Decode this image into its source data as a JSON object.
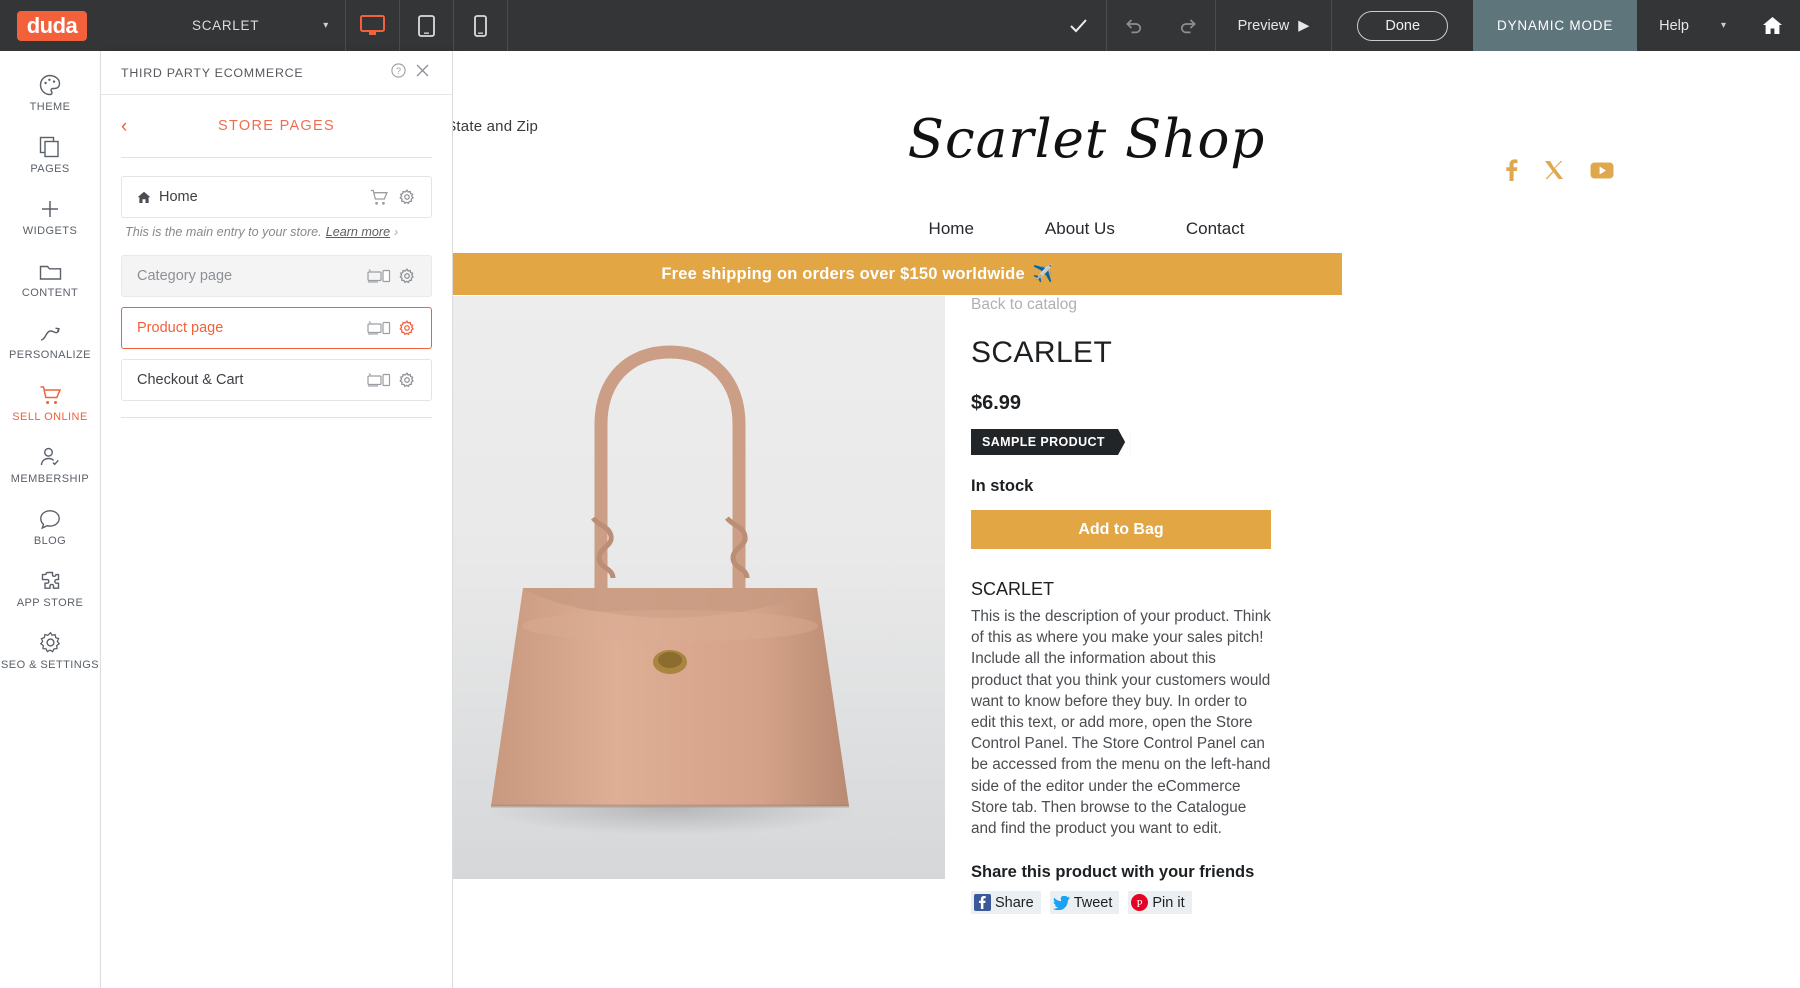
{
  "topbar": {
    "logo": "duda",
    "site_name": "SCARLET",
    "devices": [
      {
        "name": "desktop",
        "icon": "monitor-icon",
        "active": true
      },
      {
        "name": "tablet",
        "icon": "tablet-icon",
        "active": false
      },
      {
        "name": "mobile",
        "icon": "mobile-icon",
        "active": false
      }
    ],
    "save_icon": "checkmark-icon",
    "undo_icon": "undo-icon",
    "redo_icon": "redo-icon",
    "preview_label": "Preview",
    "done_label": "Done",
    "dynamic_mode_label": "DYNAMIC MODE",
    "help_label": "Help",
    "home_icon": "home-icon"
  },
  "rail": {
    "items": [
      {
        "label": "THEME",
        "icon": "palette-icon",
        "active": false
      },
      {
        "label": "PAGES",
        "icon": "pages-icon",
        "active": false
      },
      {
        "label": "WIDGETS",
        "icon": "plus-icon",
        "active": false
      },
      {
        "label": "CONTENT",
        "icon": "folder-icon",
        "active": false
      },
      {
        "label": "PERSONALIZE",
        "icon": "branch-icon",
        "active": false
      },
      {
        "label": "SELL ONLINE",
        "icon": "cart-icon",
        "active": true
      },
      {
        "label": "MEMBERSHIP",
        "icon": "user-check-icon",
        "active": false
      },
      {
        "label": "BLOG",
        "icon": "chat-icon",
        "active": false
      },
      {
        "label": "APP STORE",
        "icon": "puzzle-icon",
        "active": false
      },
      {
        "label": "SEO & SETTINGS",
        "icon": "gear-icon",
        "active": false
      }
    ],
    "active_color": "#f2603c"
  },
  "panel": {
    "title": "THIRD PARTY ECOMMERCE",
    "help_icon": "question-circle-icon",
    "close_icon": "close-icon",
    "back_icon": "chevron-left-icon",
    "subtitle": "STORE PAGES",
    "accent_color": "#f2603c",
    "pages": [
      {
        "label": "Home",
        "style": "plain",
        "lead_icon": "home-icon",
        "row_icon": "cart-icon",
        "gear_icon": "gear-icon",
        "gear_active": false,
        "selected": false
      },
      {
        "label": "Category page",
        "style": "grey",
        "lead_icon": "",
        "row_icon": "responsive-devices-icon",
        "gear_icon": "gear-icon",
        "gear_active": false,
        "selected": false
      },
      {
        "label": "Product page",
        "style": "plain",
        "lead_icon": "",
        "row_icon": "responsive-devices-icon",
        "gear_icon": "gear-icon",
        "gear_active": true,
        "selected": true
      },
      {
        "label": "Checkout & Cart",
        "style": "plain",
        "lead_icon": "",
        "row_icon": "responsive-devices-icon",
        "gear_icon": "gear-icon",
        "gear_active": false,
        "selected": false
      }
    ],
    "home_note_text": "This is the main entry to your store.",
    "home_note_link": "Learn more",
    "home_note_chevron": "›"
  },
  "site": {
    "address_line": "ity, State and Zip",
    "logo_text": "Scarlet Shop",
    "socials": [
      {
        "name": "facebook-icon"
      },
      {
        "name": "x-twitter-icon"
      },
      {
        "name": "youtube-icon"
      }
    ],
    "nav": [
      "Home",
      "About Us",
      "Contact"
    ],
    "promo_text": "Free shipping on orders over $150 worldwide",
    "promo_emoji": "✈️",
    "promo_color": "#e2a645",
    "product": {
      "back_link": "Back to catalog",
      "title": "SCARLET",
      "price": "$6.99",
      "badge": "SAMPLE PRODUCT",
      "stock": "In stock",
      "add_button": "Add to Bag",
      "desc_title": "SCARLET",
      "desc_body": "This is the description of your product. Think of this as where you make your sales pitch! Include all the information about this product that you think your customers would want to know before they buy. In order to edit this text, or add more, open the Store Control Panel. The Store Control Panel can be accessed from the menu on the left-hand side of the editor under the eCommerce Store tab. Then browse to the Catalogue and find the product you want to edit.",
      "share_title": "Share this product with your friends",
      "share_buttons": [
        {
          "label": "Share",
          "icon": "facebook-icon",
          "color": "#3b5998"
        },
        {
          "label": "Tweet",
          "icon": "twitter-icon",
          "color": "#1da1f2"
        },
        {
          "label": "Pin it",
          "icon": "pinterest-icon",
          "color": "#e60023"
        }
      ],
      "image_alt": "tan-leather-tote-bag"
    }
  }
}
